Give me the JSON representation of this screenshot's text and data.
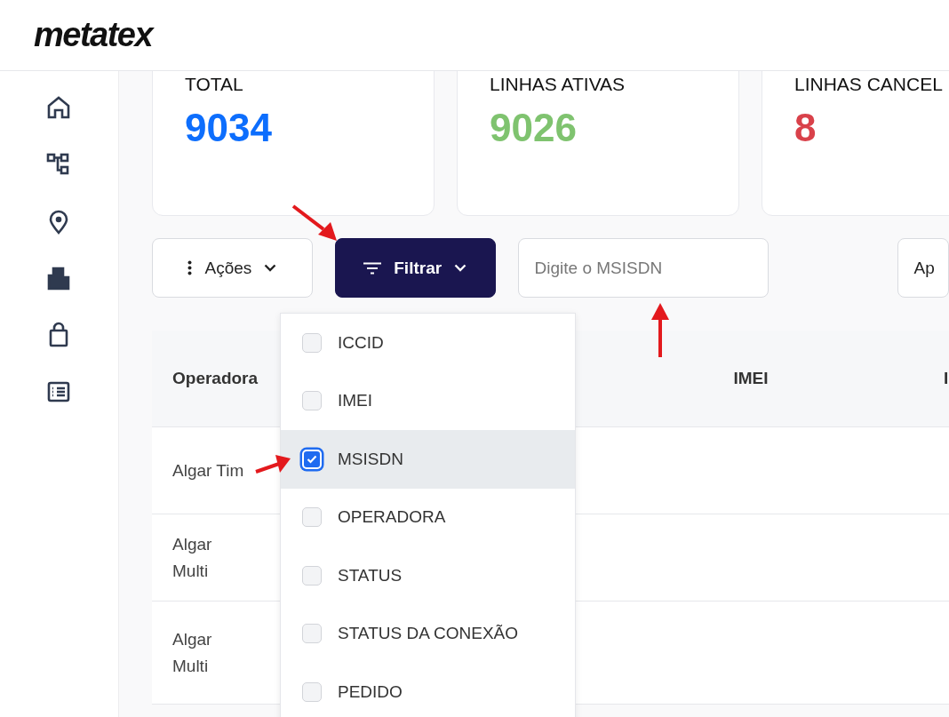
{
  "header": {
    "logo": "metatex"
  },
  "cards": [
    {
      "label": "TOTAL",
      "value": "9034",
      "color": "#0d6efd"
    },
    {
      "label": "LINHAS ATIVAS",
      "value": "9026",
      "color": "#7fc36f"
    },
    {
      "label": "LINHAS CANCEL",
      "value": "8",
      "color": "#d9414a"
    }
  ],
  "toolbar": {
    "actions_button": "Ações",
    "filter_button": "Filtrar",
    "search": {
      "placeholder": "Digite o MSISDN"
    },
    "cut_button": "Ap"
  },
  "table": {
    "columns": [
      "Operadora",
      "",
      "IMEI",
      "I"
    ],
    "rows": [
      [
        "Algar Tim"
      ],
      [
        "Algar\nMulti"
      ],
      [
        "Algar\nMulti"
      ]
    ]
  },
  "filter_menu": {
    "items": [
      {
        "label": "ICCID",
        "checked": false,
        "selected": false
      },
      {
        "label": "IMEI",
        "checked": false,
        "selected": false
      },
      {
        "label": "MSISDN",
        "checked": true,
        "selected": true
      },
      {
        "label": "OPERADORA",
        "checked": false,
        "selected": false
      },
      {
        "label": "STATUS",
        "checked": false,
        "selected": false
      },
      {
        "label": "STATUS DA CONEXÃO",
        "checked": false,
        "selected": false
      },
      {
        "label": "PEDIDO",
        "checked": false,
        "selected": false
      }
    ]
  },
  "annotations": [
    {
      "kind": "arrow"
    },
    {
      "kind": "arrow"
    },
    {
      "kind": "arrow"
    }
  ]
}
